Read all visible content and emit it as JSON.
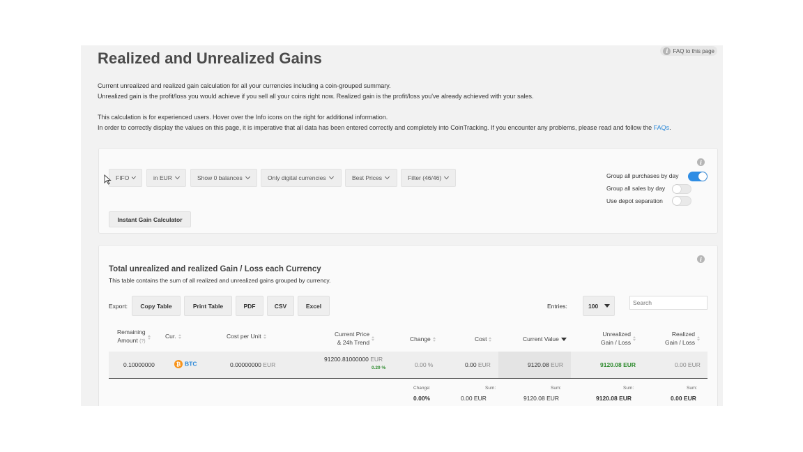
{
  "header": {
    "title": "Realized and Unrealized Gains",
    "faq_label": "FAQ to this page"
  },
  "intro": {
    "line1": "Current unrealized and realized gain calculation for all your currencies including a coin-grouped summary.",
    "line2": "Unrealized gain is the profit/loss you would achieve if you sell all your coins right now. Realized gain is the profit/loss you've already achieved with your sales.",
    "line3": "This calculation is for experienced users. Hover over the Info icons on the right for additional information.",
    "line4": "In order to correctly display the values on this page, it is imperative that all data has been entered correctly and completely into CoinTracking. If you encounter any problems, please read and follow the",
    "line4_link": "FAQs",
    "line4_end": "."
  },
  "filters": {
    "method": "FIFO",
    "currency": "in EUR",
    "balances": "Show 0 balances",
    "currencies": "Only digital currencies",
    "prices": "Best Prices",
    "filter": "Filter (46/46)",
    "instant_button": "Instant Gain Calculator"
  },
  "toggles": [
    {
      "label": "Group all purchases by day",
      "on": true
    },
    {
      "label": "Group all sales by day",
      "on": false
    },
    {
      "label": "Use depot separation",
      "on": false
    }
  ],
  "table_section": {
    "title": "Total unrealized and realized Gain / Loss each Currency",
    "subtitle": "This table contains the sum of all realized and unrealized gains grouped by currency.",
    "export_label": "Export:",
    "export_buttons": [
      "Copy Table",
      "Print Table",
      "PDF",
      "CSV",
      "Excel"
    ],
    "entries_label": "Entries:",
    "entries_value": "100",
    "search_placeholder": "Search"
  },
  "columns": {
    "remaining_1": "Remaining",
    "remaining_2": "Amount",
    "remaining_hint": "(?)",
    "cur": "Cur.",
    "cost_per_unit": "Cost per Unit",
    "price_1": "Current Price",
    "price_2": "& 24h Trend",
    "change": "Change",
    "cost": "Cost",
    "current_value": "Current Value",
    "unrealized_1": "Unrealized",
    "unrealized_2": "Gain / Loss",
    "realized_1": "Realized",
    "realized_2": "Gain / Loss"
  },
  "rows": [
    {
      "amount": "0.10000000",
      "currency": "BTC",
      "cost_per_unit": "0.00000000",
      "cost_per_unit_unit": "EUR",
      "price": "91200.81000000",
      "price_unit": "EUR",
      "trend": "0.29 %",
      "change": "0.00 %",
      "cost": "0.00",
      "cost_unit": "EUR",
      "current_value": "9120.08",
      "current_value_unit": "EUR",
      "unrealized": "9120.08 EUR",
      "realized": "0.00",
      "realized_unit": "EUR"
    }
  ],
  "totals": {
    "change_label": "Change:",
    "change_value": "0.00%",
    "cost_label": "Sum:",
    "cost_value": "0.00 EUR",
    "value_label": "Sum:",
    "value_value": "9120.08 EUR",
    "unrealized_label": "Sum:",
    "unrealized_value": "9120.08 EUR",
    "realized_label": "Sum:",
    "realized_value": "0.00 EUR"
  },
  "colors": {
    "accent": "#2f8de4",
    "gain_green": "#2e8b2e",
    "btc_orange": "#f7931a",
    "link_blue": "#2a88d8"
  },
  "icons": [
    "info-icon",
    "chevron-down-icon",
    "sort-icon",
    "bitcoin-icon",
    "mouse-cursor-icon"
  ]
}
